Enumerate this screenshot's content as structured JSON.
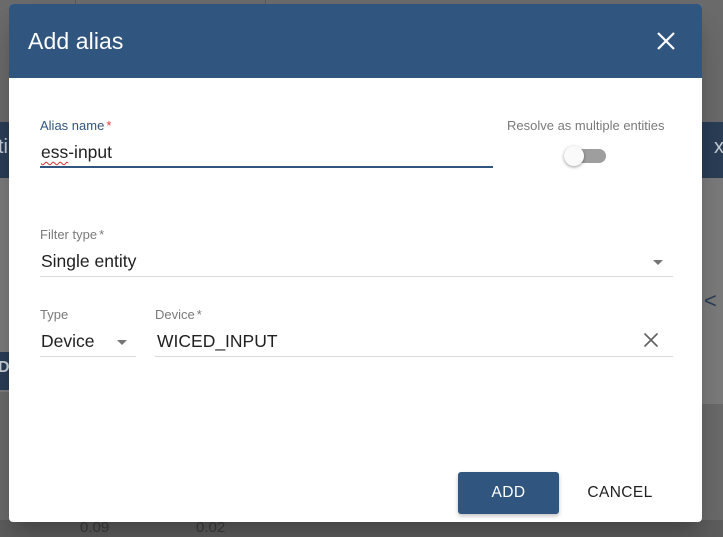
{
  "background": {
    "left_panel_glyphs": [
      "ti",
      "D"
    ],
    "right_panel_glyphs": [
      "x",
      "<"
    ],
    "table_values": [
      "0.09",
      "0.02"
    ]
  },
  "dialog": {
    "title": "Add alias",
    "close_icon": "close-icon",
    "alias_name": {
      "label": "Alias name",
      "required_mark": "*",
      "value_misspelled_part": "ess",
      "value_rest": "-input"
    },
    "resolve_multiple": {
      "label": "Resolve as multiple entities",
      "checked": false
    },
    "filter_type": {
      "label": "Filter type",
      "required_mark": "*",
      "value": "Single entity"
    },
    "type": {
      "label": "Type",
      "value": "Device"
    },
    "device": {
      "label": "Device",
      "required_mark": "*",
      "value": "WICED_INPUT"
    },
    "buttons": {
      "add": "ADD",
      "cancel": "CANCEL"
    },
    "colors": {
      "primary": "#305680",
      "required": "#e53935"
    }
  }
}
